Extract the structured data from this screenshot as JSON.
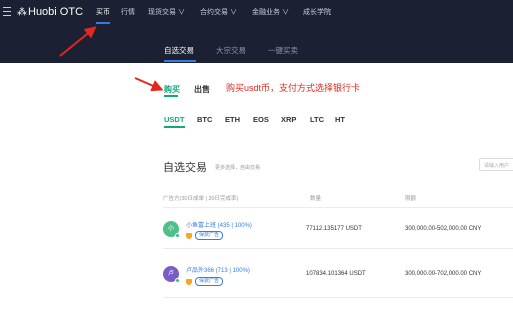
{
  "header": {
    "logo_text": "Huobi OTC",
    "nav": [
      {
        "label": "买币"
      },
      {
        "label": "行情"
      },
      {
        "label": "现货交易 ∨"
      },
      {
        "label": "合约交易 ∨"
      },
      {
        "label": "金融业务 ∨"
      },
      {
        "label": "成长学院"
      }
    ]
  },
  "subnav": {
    "tabs": [
      {
        "label": "自选交易"
      },
      {
        "label": "大宗交易"
      },
      {
        "label": "一键买卖"
      }
    ]
  },
  "trade": {
    "buy_label": "购买",
    "sell_label": "出售",
    "annotation": "购买usdt币，支付方式选择银行卡"
  },
  "coins": [
    "USDT",
    "BTC",
    "ETH",
    "EOS",
    "XRP",
    "LTC",
    "HT"
  ],
  "section": {
    "title": "自选交易",
    "hint": "更多选择，自由交易",
    "search_placeholder": "请输入用户"
  },
  "table": {
    "columns": [
      "广告方(30日成单 | 30日完成率)",
      "数量",
      "限额"
    ],
    "rows": [
      {
        "avatar_char": "小",
        "avatar_color": "#4fbf8a",
        "merchant": "小鱼富上班 (435 | 100%)",
        "badge": "保费广告",
        "quantity": "77112.135177 USDT",
        "limit": "300,000.00-502,000.00 CNY"
      },
      {
        "avatar_char": "卢",
        "avatar_color": "#7b5cc4",
        "merchant": "卢品外366 (713 | 100%)",
        "badge": "保费广告",
        "quantity": "107834.101364 USDT",
        "limit": "300,000.00-702,000.00 CNY"
      }
    ]
  },
  "colors": {
    "header_bg": "#1b2033",
    "accent_green": "#14a77a",
    "accent_blue": "#357ce1",
    "annotation_red": "#e0281e"
  }
}
